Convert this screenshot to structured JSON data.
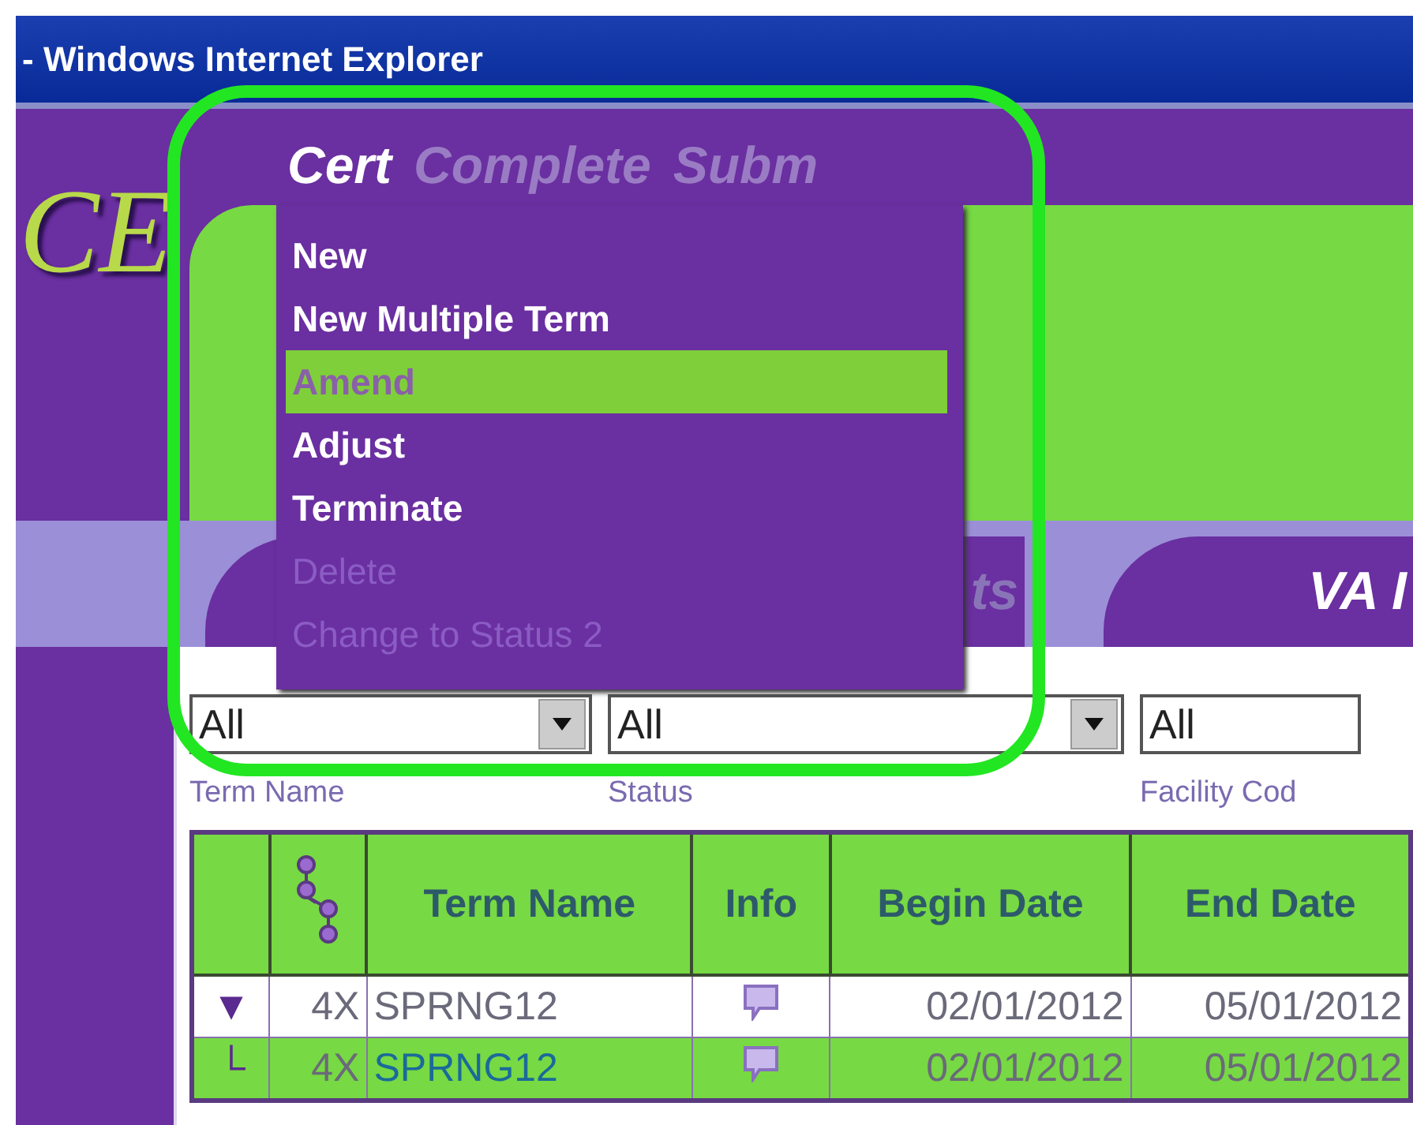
{
  "window": {
    "title": "- Windows Internet Explorer"
  },
  "logo": "CE",
  "menu": [
    {
      "label": "Cert",
      "selected": true
    },
    {
      "label": "Complete",
      "selected": false
    },
    {
      "label": "Subm",
      "selected": false
    }
  ],
  "dropdown": {
    "items": [
      {
        "label": "New",
        "selected": false,
        "disabled": false
      },
      {
        "label": "New Multiple Term",
        "selected": false,
        "disabled": false
      },
      {
        "label": "Amend",
        "selected": true,
        "disabled": false
      },
      {
        "label": "Adjust",
        "selected": false,
        "disabled": false
      },
      {
        "label": "Terminate",
        "selected": false,
        "disabled": false
      },
      {
        "label": "Delete",
        "selected": false,
        "disabled": true
      },
      {
        "label": "Change to Status 2",
        "selected": false,
        "disabled": true
      }
    ]
  },
  "tabs": [
    {
      "label": "ts"
    },
    {
      "label": "VA I"
    }
  ],
  "filters": [
    {
      "value": "All",
      "arrow": true
    },
    {
      "value": "All",
      "arrow": true
    },
    {
      "value": "All",
      "arrow": false
    }
  ],
  "filter_labels": [
    "Term Name",
    "Status",
    "Facility Cod"
  ],
  "table": {
    "columns": [
      {
        "kind": "blank"
      },
      {
        "kind": "tree"
      },
      {
        "kind": "text",
        "label": "Term Name"
      },
      {
        "kind": "text",
        "label": "Info"
      },
      {
        "kind": "text",
        "label": "Begin Date"
      },
      {
        "kind": "text",
        "label": "End Date"
      }
    ],
    "rows": [
      {
        "highlighted": false,
        "expander": "▼",
        "code": "4X",
        "term": "SPRNG12",
        "begin": "02/01/2012",
        "end": "05/01/2012"
      },
      {
        "highlighted": true,
        "expander": "└",
        "code": "4X",
        "term": "SPRNG12",
        "begin": "02/01/2012",
        "end": "05/01/2012"
      }
    ]
  },
  "annotation": {
    "kind": "outline"
  }
}
